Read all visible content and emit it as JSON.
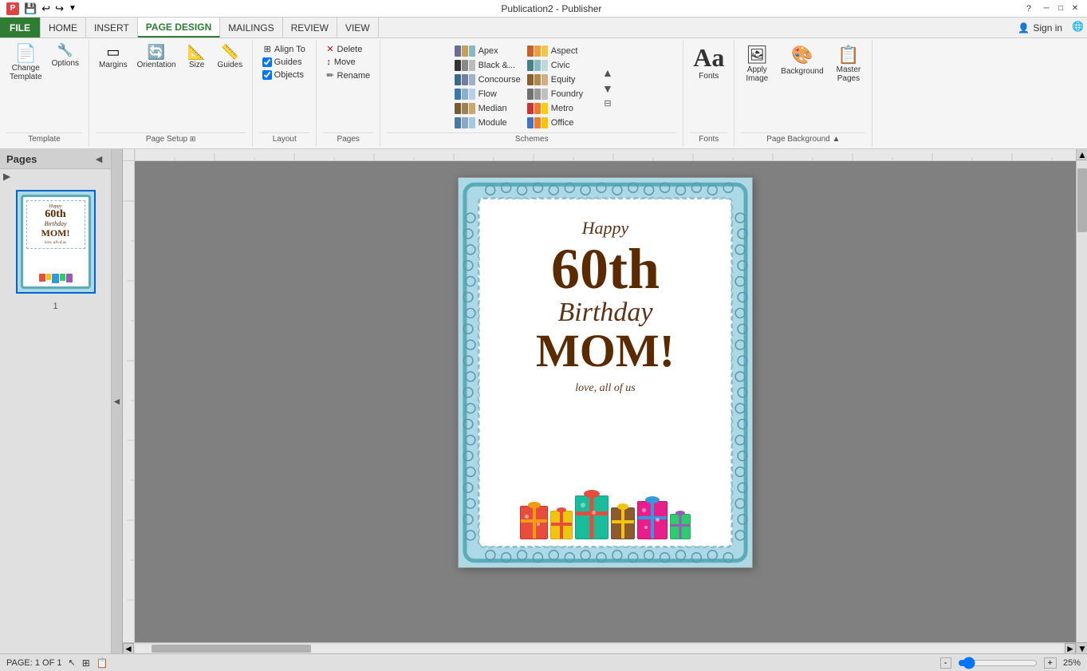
{
  "titleBar": {
    "title": "Publication2 - Publisher",
    "helpBtn": "?",
    "minimizeBtn": "─",
    "restoreBtn": "□",
    "closeBtn": "✕"
  },
  "ribbon": {
    "tabs": [
      {
        "id": "file",
        "label": "FILE",
        "type": "file"
      },
      {
        "id": "home",
        "label": "HOME",
        "type": "normal"
      },
      {
        "id": "insert",
        "label": "INSERT",
        "type": "normal"
      },
      {
        "id": "page-design",
        "label": "PAGE DESIGN",
        "type": "active"
      },
      {
        "id": "mailings",
        "label": "MAILINGS",
        "type": "normal"
      },
      {
        "id": "review",
        "label": "REVIEW",
        "type": "normal"
      },
      {
        "id": "view",
        "label": "VIEW",
        "type": "normal"
      }
    ],
    "signIn": "Sign in",
    "groups": {
      "template": {
        "label": "Template",
        "changeBtn": "Change\nTemplate",
        "optionsBtn": "Options"
      },
      "pageSetup": {
        "label": "Page Setup",
        "marginsBtn": "Margins",
        "orientationBtn": "Orientation",
        "sizeBtn": "Size",
        "guidesBtn": "Guides",
        "expandBtn": "⊞"
      },
      "layout": {
        "label": "Layout",
        "alignToLabel": "Align To",
        "guidesCheck": "Guides",
        "objectsCheck": "Objects"
      },
      "pages": {
        "label": "Pages",
        "deleteBtn": "Delete",
        "moveBtn": "Move",
        "renameBtn": "Rename"
      },
      "schemes": {
        "label": "Schemes",
        "items": [
          {
            "name": "Apex",
            "colors": [
              "#6b6b9a",
              "#8b8bb0",
              "#c0c0d8",
              "#9a6b6b",
              "#b08b8b"
            ]
          },
          {
            "name": "Aspect",
            "colors": [
              "#ce6c2a",
              "#e8a04a",
              "#f0c878",
              "#8a2020",
              "#b84040"
            ]
          },
          {
            "name": "Black &...",
            "colors": [
              "#333333",
              "#666666",
              "#999999",
              "#cccccc",
              "#eeeeee"
            ]
          },
          {
            "name": "Civic",
            "colors": [
              "#488088",
              "#60a0a8",
              "#88c8d0",
              "#a86048",
              "#c88060"
            ]
          },
          {
            "name": "Concourse",
            "colors": [
              "#3a6c8a",
              "#5a8caa",
              "#8ab0c8",
              "#6a3a3a",
              "#8a5a5a"
            ]
          },
          {
            "name": "Equity",
            "colors": [
              "#8a6030",
              "#aa8050",
              "#c8a878",
              "#306030",
              "#508050"
            ]
          },
          {
            "name": "Flow",
            "colors": [
              "#3878a8",
              "#5898c8",
              "#88b8d8",
              "#a87038",
              "#c89058"
            ]
          },
          {
            "name": "Foundry",
            "colors": [
              "#606060",
              "#808080",
              "#a8a8a8",
              "#404040",
              "#505050"
            ]
          },
          {
            "name": "Median",
            "colors": [
              "#7a5a30",
              "#9a7a50",
              "#baa878",
              "#305030",
              "#507050"
            ]
          },
          {
            "name": "Metro",
            "colors": [
              "#cc3333",
              "#ee5555",
              "#ff8888",
              "#3333cc",
              "#5555ee"
            ]
          },
          {
            "name": "Module",
            "colors": [
              "#4878a8",
              "#6898c8",
              "#98b8d8",
              "#a84848",
              "#c86868"
            ]
          },
          {
            "name": "Office",
            "colors": [
              "#4472c4",
              "#70a0d0",
              "#9ecae1",
              "#ed7d31",
              "#ffc000"
            ]
          }
        ],
        "arrowUp": "▲",
        "arrowDown": "▼"
      },
      "fonts": {
        "label": "Fonts",
        "icon": "Aa"
      },
      "pageBackground": {
        "label": "Page Background",
        "applyImageLabel": "Apply\nImage",
        "backgroundLabel": "Background",
        "masterPagesLabel": "Master\nPages"
      }
    }
  },
  "pagesPanel": {
    "title": "Pages",
    "collapseBtn": "◄",
    "pageNum": "1",
    "thumbnailAlt": "Birthday card page 1"
  },
  "canvas": {
    "card": {
      "happyText": "Happy",
      "sixtiethText": "60th",
      "birthdayText": "Birthday",
      "momText": "MOM!",
      "loveText": "love, all of us"
    }
  },
  "statusBar": {
    "pageInfo": "PAGE: 1 OF 1",
    "zoomLevel": "25%",
    "zoomInBtn": "+",
    "zoomOutBtn": "-"
  }
}
